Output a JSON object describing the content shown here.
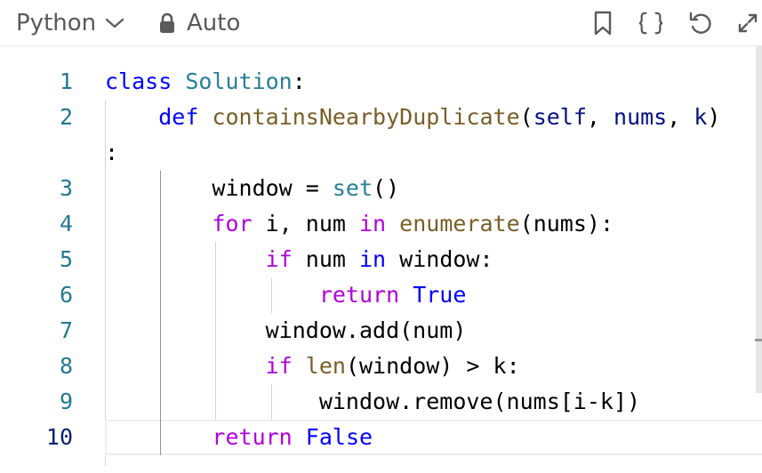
{
  "toolbar": {
    "language": "Python",
    "mode": "Auto",
    "icons": [
      "bookmark-icon",
      "braces-icon",
      "undo-icon",
      "expand-icon"
    ]
  },
  "editor": {
    "active_line": 10,
    "lines": [
      {
        "number": "1",
        "segments": [
          {
            "t": "class",
            "c": "kw"
          },
          {
            "t": " ",
            "c": ""
          },
          {
            "t": "Solution",
            "c": "cls"
          },
          {
            "t": ":",
            "c": ""
          }
        ]
      },
      {
        "number": "2",
        "segments": [
          {
            "t": "    ",
            "c": ""
          },
          {
            "t": "def",
            "c": "kw"
          },
          {
            "t": " ",
            "c": ""
          },
          {
            "t": "containsNearbyDuplicate",
            "c": "fn"
          },
          {
            "t": "(",
            "c": ""
          },
          {
            "t": "self",
            "c": "var"
          },
          {
            "t": ", ",
            "c": ""
          },
          {
            "t": "nums",
            "c": "var"
          },
          {
            "t": ", ",
            "c": ""
          },
          {
            "t": "k",
            "c": "var"
          },
          {
            "t": ")",
            "c": ""
          }
        ]
      },
      {
        "number": "",
        "segments": [
          {
            "t": ":",
            "c": ""
          }
        ]
      },
      {
        "number": "3",
        "segments": [
          {
            "t": "        window = ",
            "c": ""
          },
          {
            "t": "set",
            "c": "cls"
          },
          {
            "t": "()",
            "c": ""
          }
        ]
      },
      {
        "number": "4",
        "segments": [
          {
            "t": "        ",
            "c": ""
          },
          {
            "t": "for",
            "c": "kw2"
          },
          {
            "t": " i, num ",
            "c": ""
          },
          {
            "t": "in",
            "c": "kw2"
          },
          {
            "t": " ",
            "c": ""
          },
          {
            "t": "enumerate",
            "c": "fn"
          },
          {
            "t": "(nums):",
            "c": ""
          }
        ]
      },
      {
        "number": "5",
        "segments": [
          {
            "t": "            ",
            "c": ""
          },
          {
            "t": "if",
            "c": "kw2"
          },
          {
            "t": " num ",
            "c": ""
          },
          {
            "t": "in",
            "c": "kw"
          },
          {
            "t": " window:",
            "c": ""
          }
        ]
      },
      {
        "number": "6",
        "segments": [
          {
            "t": "                ",
            "c": ""
          },
          {
            "t": "return",
            "c": "kw2"
          },
          {
            "t": " ",
            "c": ""
          },
          {
            "t": "True",
            "c": "kw"
          }
        ]
      },
      {
        "number": "7",
        "segments": [
          {
            "t": "            window.add(num)",
            "c": ""
          }
        ]
      },
      {
        "number": "8",
        "segments": [
          {
            "t": "            ",
            "c": ""
          },
          {
            "t": "if",
            "c": "kw2"
          },
          {
            "t": " ",
            "c": ""
          },
          {
            "t": "len",
            "c": "fn"
          },
          {
            "t": "(window) > k:",
            "c": ""
          }
        ]
      },
      {
        "number": "9",
        "segments": [
          {
            "t": "                window.remove(nums[i-k])",
            "c": ""
          }
        ]
      },
      {
        "number": "10",
        "segments": [
          {
            "t": "        ",
            "c": ""
          },
          {
            "t": "return",
            "c": "kw2"
          },
          {
            "t": " ",
            "c": ""
          },
          {
            "t": "False",
            "c": "kw"
          }
        ]
      }
    ]
  }
}
